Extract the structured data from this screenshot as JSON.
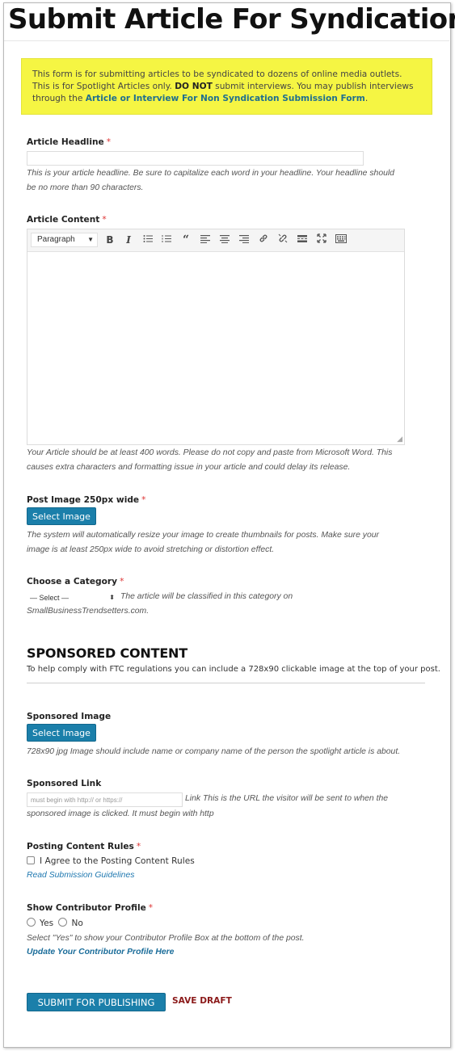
{
  "page": {
    "title": "Submit Article For Syndication"
  },
  "notice": {
    "text_before": "This form is for submitting articles to be syndicated to dozens of online media outlets. This is for Spotlight Articles only. ",
    "bold": "DO NOT",
    "text_middle": " submit interviews. You may publish interviews through the ",
    "link": "Article or Interview For Non Syndication Submission Form",
    "text_end": "."
  },
  "headline": {
    "label": "Article Headline",
    "required": "*",
    "value": "",
    "help_line1": "This is your article headline. Be sure to capitalize each word in your headline. Your headline should",
    "help_line2": "be no more than 90 characters."
  },
  "content": {
    "label": "Article Content",
    "required": "*",
    "format_select": "Paragraph",
    "toolbar_icons": [
      "bold-icon",
      "italic-icon",
      "bullet-list-icon",
      "numbered-list-icon",
      "blockquote-icon",
      "align-left-icon",
      "align-center-icon",
      "align-right-icon",
      "link-icon",
      "unlink-icon",
      "read-more-icon",
      "fullscreen-icon",
      "toolbar-toggle-icon"
    ],
    "help_line1": "Your Article should be at least 400 words. Please do not copy and paste from Microsoft Word. This",
    "help_line2": "causes extra characters and formatting issue in your article and could delay its release."
  },
  "post_image": {
    "label": "Post Image 250px wide",
    "required": "*",
    "button": "Select Image",
    "help_line1": "The system will automatically resize your image to create thumbnails for posts. Make sure your",
    "help_line2": "image is at least 250px wide to avoid stretching or distortion effect."
  },
  "category": {
    "label": "Choose a Category",
    "required": "*",
    "selected": "— Select —",
    "help_inline": "The article will be classified in this category on",
    "help_line2": "SmallBusinessTrendsetters.com."
  },
  "sponsored": {
    "title": "SPONSORED CONTENT",
    "subtitle": "To help comply with FTC regulations you can include a 728x90 clickable image at the top of your post."
  },
  "sponsored_image": {
    "label": "Sponsored Image",
    "button": "Select Image",
    "help": "728x90 jpg Image should include name or company name of the person the spotlight article is about."
  },
  "sponsored_link": {
    "label": "Sponsored Link",
    "placeholder": "must begin with http:// or https://",
    "help_inline": "Link This is the URL the visitor will be sent to when the",
    "help_line2": "sponsored image is clicked. It must begin with http"
  },
  "rules": {
    "label": "Posting Content Rules",
    "required": "*",
    "checkbox_label": "I Agree to the Posting Content Rules",
    "link": "Read Submission Guidelines"
  },
  "profile": {
    "label": "Show Contributor Profile",
    "required": "*",
    "option_yes": "Yes",
    "option_no": "No",
    "help": "Select \"Yes\" to show your Contributor Profile Box at the bottom of the post.",
    "link": "Update Your Contributor Profile Here"
  },
  "actions": {
    "submit": "SUBMIT FOR PUBLISHING",
    "save_draft": "SAVE DRAFT"
  }
}
